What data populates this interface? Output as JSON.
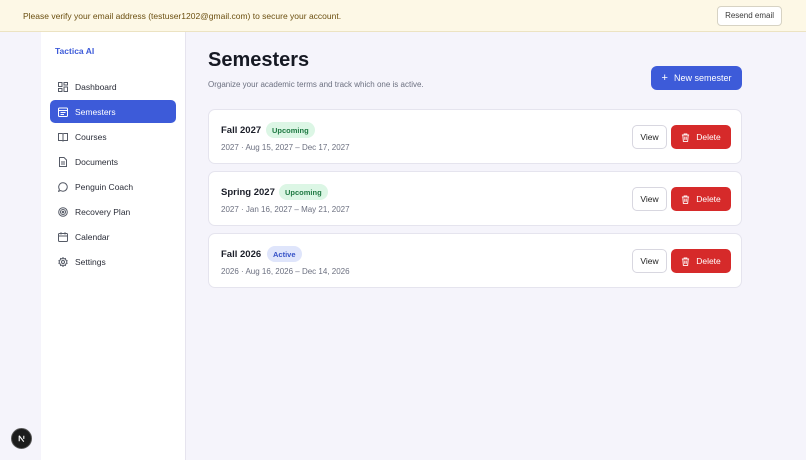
{
  "banner": {
    "message": "Please verify your email address (testuser1202@gmail.com) to secure your account.",
    "resend_label": "Resend email"
  },
  "sidebar": {
    "brand": "Tactica AI",
    "items": [
      {
        "label": "Dashboard",
        "icon": "dashboard-icon",
        "active": false
      },
      {
        "label": "Semesters",
        "icon": "calendar-list-icon",
        "active": true
      },
      {
        "label": "Courses",
        "icon": "book-icon",
        "active": false
      },
      {
        "label": "Documents",
        "icon": "document-icon",
        "active": false
      },
      {
        "label": "Penguin Coach",
        "icon": "chat-icon",
        "active": false
      },
      {
        "label": "Recovery Plan",
        "icon": "target-icon",
        "active": false
      },
      {
        "label": "Calendar",
        "icon": "calendar-icon",
        "active": false
      },
      {
        "label": "Settings",
        "icon": "gear-icon",
        "active": false
      }
    ]
  },
  "main": {
    "title": "Semesters",
    "subtitle": "Organize your academic terms and track which one is active.",
    "new_button_label": "New semester",
    "view_label": "View",
    "delete_label": "Delete",
    "semesters": [
      {
        "name": "Fall 2027",
        "status": "Upcoming",
        "meta": "2027 · Aug 15, 2027 – Dec 17, 2027"
      },
      {
        "name": "Spring 2027",
        "status": "Upcoming",
        "meta": "2027 · Jan 16, 2027 – May 21, 2027"
      },
      {
        "name": "Fall 2026",
        "status": "Active",
        "meta": "2026 · Aug 16, 2026 – Dec 14, 2026"
      }
    ]
  },
  "colors": {
    "accent": "#3d5bd9",
    "danger": "#d62a2a",
    "banner_bg": "#fdf8e6",
    "upcoming_badge": "#dcf6e5",
    "active_badge": "#dfe5fb"
  }
}
